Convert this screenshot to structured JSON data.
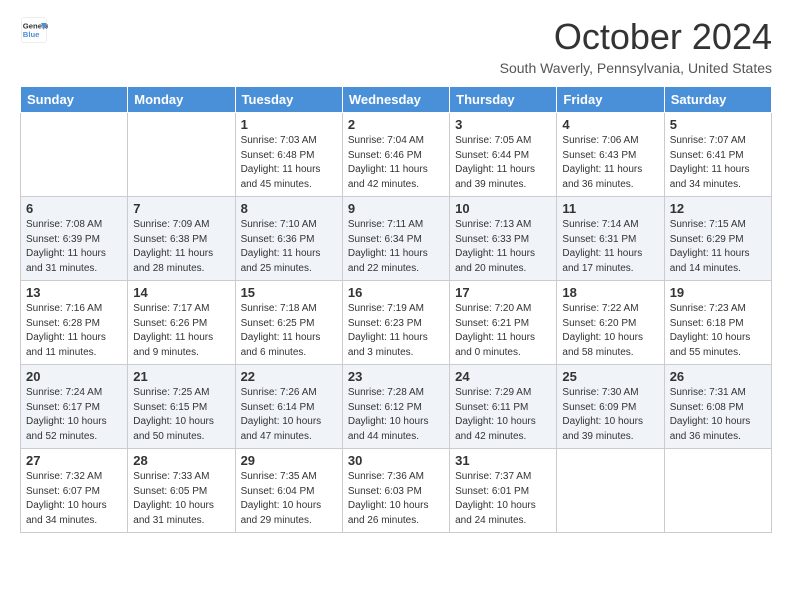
{
  "header": {
    "logo_line1": "General",
    "logo_line2": "Blue",
    "month": "October 2024",
    "location": "South Waverly, Pennsylvania, United States"
  },
  "weekdays": [
    "Sunday",
    "Monday",
    "Tuesday",
    "Wednesday",
    "Thursday",
    "Friday",
    "Saturday"
  ],
  "weeks": [
    [
      {
        "day": "",
        "info": ""
      },
      {
        "day": "",
        "info": ""
      },
      {
        "day": "1",
        "info": "Sunrise: 7:03 AM\nSunset: 6:48 PM\nDaylight: 11 hours and 45 minutes."
      },
      {
        "day": "2",
        "info": "Sunrise: 7:04 AM\nSunset: 6:46 PM\nDaylight: 11 hours and 42 minutes."
      },
      {
        "day": "3",
        "info": "Sunrise: 7:05 AM\nSunset: 6:44 PM\nDaylight: 11 hours and 39 minutes."
      },
      {
        "day": "4",
        "info": "Sunrise: 7:06 AM\nSunset: 6:43 PM\nDaylight: 11 hours and 36 minutes."
      },
      {
        "day": "5",
        "info": "Sunrise: 7:07 AM\nSunset: 6:41 PM\nDaylight: 11 hours and 34 minutes."
      }
    ],
    [
      {
        "day": "6",
        "info": "Sunrise: 7:08 AM\nSunset: 6:39 PM\nDaylight: 11 hours and 31 minutes."
      },
      {
        "day": "7",
        "info": "Sunrise: 7:09 AM\nSunset: 6:38 PM\nDaylight: 11 hours and 28 minutes."
      },
      {
        "day": "8",
        "info": "Sunrise: 7:10 AM\nSunset: 6:36 PM\nDaylight: 11 hours and 25 minutes."
      },
      {
        "day": "9",
        "info": "Sunrise: 7:11 AM\nSunset: 6:34 PM\nDaylight: 11 hours and 22 minutes."
      },
      {
        "day": "10",
        "info": "Sunrise: 7:13 AM\nSunset: 6:33 PM\nDaylight: 11 hours and 20 minutes."
      },
      {
        "day": "11",
        "info": "Sunrise: 7:14 AM\nSunset: 6:31 PM\nDaylight: 11 hours and 17 minutes."
      },
      {
        "day": "12",
        "info": "Sunrise: 7:15 AM\nSunset: 6:29 PM\nDaylight: 11 hours and 14 minutes."
      }
    ],
    [
      {
        "day": "13",
        "info": "Sunrise: 7:16 AM\nSunset: 6:28 PM\nDaylight: 11 hours and 11 minutes."
      },
      {
        "day": "14",
        "info": "Sunrise: 7:17 AM\nSunset: 6:26 PM\nDaylight: 11 hours and 9 minutes."
      },
      {
        "day": "15",
        "info": "Sunrise: 7:18 AM\nSunset: 6:25 PM\nDaylight: 11 hours and 6 minutes."
      },
      {
        "day": "16",
        "info": "Sunrise: 7:19 AM\nSunset: 6:23 PM\nDaylight: 11 hours and 3 minutes."
      },
      {
        "day": "17",
        "info": "Sunrise: 7:20 AM\nSunset: 6:21 PM\nDaylight: 11 hours and 0 minutes."
      },
      {
        "day": "18",
        "info": "Sunrise: 7:22 AM\nSunset: 6:20 PM\nDaylight: 10 hours and 58 minutes."
      },
      {
        "day": "19",
        "info": "Sunrise: 7:23 AM\nSunset: 6:18 PM\nDaylight: 10 hours and 55 minutes."
      }
    ],
    [
      {
        "day": "20",
        "info": "Sunrise: 7:24 AM\nSunset: 6:17 PM\nDaylight: 10 hours and 52 minutes."
      },
      {
        "day": "21",
        "info": "Sunrise: 7:25 AM\nSunset: 6:15 PM\nDaylight: 10 hours and 50 minutes."
      },
      {
        "day": "22",
        "info": "Sunrise: 7:26 AM\nSunset: 6:14 PM\nDaylight: 10 hours and 47 minutes."
      },
      {
        "day": "23",
        "info": "Sunrise: 7:28 AM\nSunset: 6:12 PM\nDaylight: 10 hours and 44 minutes."
      },
      {
        "day": "24",
        "info": "Sunrise: 7:29 AM\nSunset: 6:11 PM\nDaylight: 10 hours and 42 minutes."
      },
      {
        "day": "25",
        "info": "Sunrise: 7:30 AM\nSunset: 6:09 PM\nDaylight: 10 hours and 39 minutes."
      },
      {
        "day": "26",
        "info": "Sunrise: 7:31 AM\nSunset: 6:08 PM\nDaylight: 10 hours and 36 minutes."
      }
    ],
    [
      {
        "day": "27",
        "info": "Sunrise: 7:32 AM\nSunset: 6:07 PM\nDaylight: 10 hours and 34 minutes."
      },
      {
        "day": "28",
        "info": "Sunrise: 7:33 AM\nSunset: 6:05 PM\nDaylight: 10 hours and 31 minutes."
      },
      {
        "day": "29",
        "info": "Sunrise: 7:35 AM\nSunset: 6:04 PM\nDaylight: 10 hours and 29 minutes."
      },
      {
        "day": "30",
        "info": "Sunrise: 7:36 AM\nSunset: 6:03 PM\nDaylight: 10 hours and 26 minutes."
      },
      {
        "day": "31",
        "info": "Sunrise: 7:37 AM\nSunset: 6:01 PM\nDaylight: 10 hours and 24 minutes."
      },
      {
        "day": "",
        "info": ""
      },
      {
        "day": "",
        "info": ""
      }
    ]
  ]
}
